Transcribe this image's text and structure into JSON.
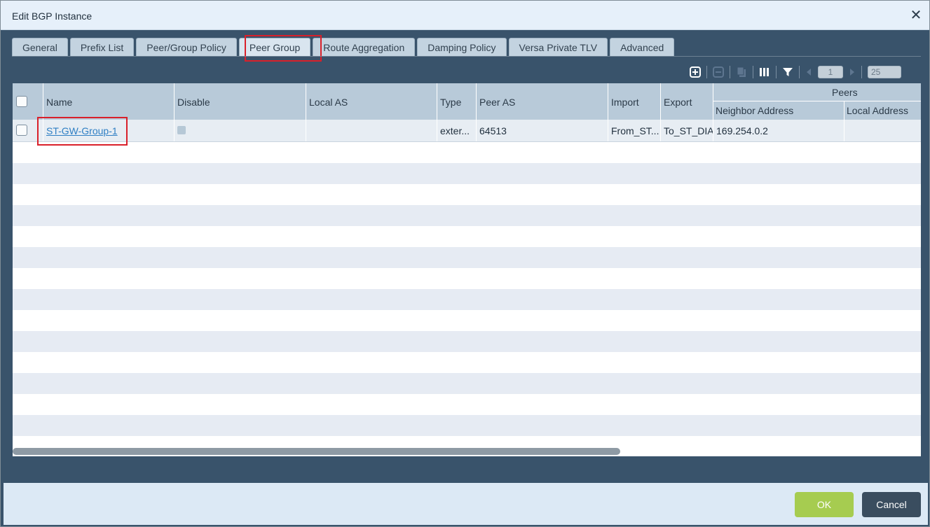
{
  "dialog": {
    "title": "Edit BGP Instance"
  },
  "tabs": [
    {
      "label": "General"
    },
    {
      "label": "Prefix List"
    },
    {
      "label": "Peer/Group Policy"
    },
    {
      "label": "Peer Group"
    },
    {
      "label": "Route Aggregation"
    },
    {
      "label": "Damping Policy"
    },
    {
      "label": "Versa Private TLV"
    },
    {
      "label": "Advanced"
    }
  ],
  "active_tab": "Peer Group",
  "toolbar": {
    "page": "1",
    "page_size": "25"
  },
  "table": {
    "headers": {
      "name": "Name",
      "disable": "Disable",
      "local_as": "Local AS",
      "type": "Type",
      "peer_as": "Peer AS",
      "import": "Import",
      "export": "Export",
      "peers": "Peers",
      "neighbor_address": "Neighbor Address",
      "local_address": "Local Address"
    },
    "rows": [
      {
        "name": "ST-GW-Group-1",
        "local_as": "",
        "type": "exter...",
        "peer_as": "64513",
        "import": "From_ST...",
        "export": "To_ST_DIA",
        "neighbor_address": "169.254.0.2",
        "local_address": ""
      }
    ]
  },
  "footer": {
    "ok_label": "OK",
    "cancel_label": "Cancel"
  },
  "colors": {
    "accent_ok": "#a6cc50",
    "cancel": "#3a4d5f",
    "highlight": "#d9202a",
    "link": "#2f7fc4"
  }
}
